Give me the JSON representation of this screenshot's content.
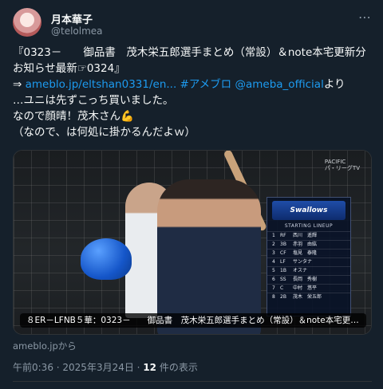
{
  "author": {
    "name": "月本華子",
    "handle": "@telolmea"
  },
  "more_icon": "more-horizontal-icon",
  "tweet": {
    "line1": "『0323－　　御品書　茂木栄五郎選手まとめ（常設）＆note本宅更新分お知らせ最新☞0324』",
    "arrow": "⇒ ",
    "link_blog": "ameblo.jp/eltshan0331/en...",
    "space1": " ",
    "hashtag": "#アメブロ",
    "space2": " ",
    "mention": "@ameba_official",
    "after_mention": "より",
    "line3": "…ユニは先ずこっち買いました。",
    "line4": "なので顔晴！茂木さん💪",
    "line5": "（なので、は何処に掛かるんだよｗ）"
  },
  "media": {
    "broadcast_tag": "PACIFIC\nパ・リーグTV",
    "lineup": {
      "team_logo": "Swallows",
      "title": "STARTING LINEUP",
      "rows": [
        {
          "no": "1",
          "pos": "RF",
          "name": "西川　遥輝"
        },
        {
          "no": "2",
          "pos": "3B",
          "name": "赤羽　由紘"
        },
        {
          "no": "3",
          "pos": "CF",
          "name": "塩見　泰隆"
        },
        {
          "no": "4",
          "pos": "LF",
          "name": "サンタナ"
        },
        {
          "no": "5",
          "pos": "1B",
          "name": "オスナ"
        },
        {
          "no": "6",
          "pos": "SS",
          "name": "長岡　秀樹"
        },
        {
          "no": "7",
          "pos": "C",
          "name": "中村　悠平"
        },
        {
          "no": "8",
          "pos": "2B",
          "name": "茂木　栄五郎"
        }
      ]
    },
    "caption": "８ER－LFNB５華：0323－　　御品書　茂木栄五郎選手まとめ（常設）＆note本宅更新分..."
  },
  "source": "ameblo.jpから",
  "meta": {
    "time": "午前0:36",
    "sep1": " · ",
    "date": "2025年3月24日",
    "sep2": " · ",
    "views": "12",
    "views_label": " 件の表示"
  },
  "colors": {
    "background": "#15202b",
    "link": "#1d9bf0",
    "muted": "#8b98a5"
  }
}
